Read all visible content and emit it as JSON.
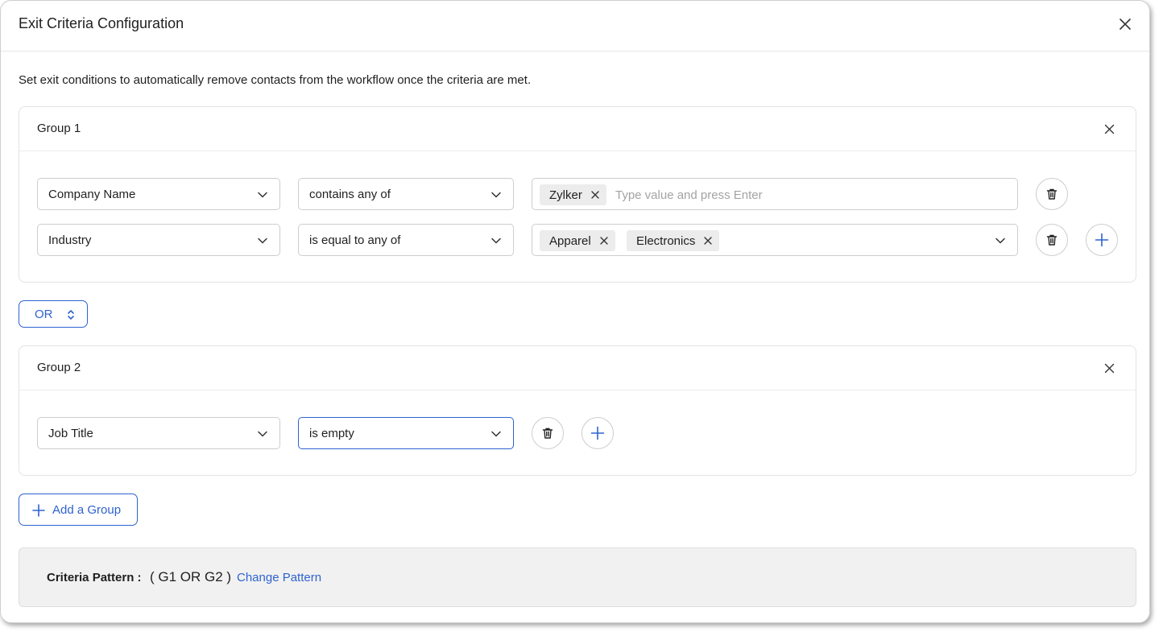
{
  "dialog": {
    "title": "Exit Criteria Configuration",
    "description": "Set exit conditions to automatically remove contacts from the workflow once the criteria are met."
  },
  "groups": [
    {
      "title": "Group 1",
      "rows": [
        {
          "field": "Company Name",
          "operator": "contains any of",
          "chips": [
            "Zylker"
          ],
          "input_placeholder": "Type value and press Enter"
        },
        {
          "field": "Industry",
          "operator": "is equal to any of",
          "chips": [
            "Apparel",
            "Electronics"
          ]
        }
      ]
    },
    {
      "title": "Group 2",
      "rows": [
        {
          "field": "Job Title",
          "operator": "is empty"
        }
      ]
    }
  ],
  "connector": {
    "label": "OR"
  },
  "add_group": {
    "label": "Add a Group"
  },
  "pattern": {
    "label": "Criteria Pattern :",
    "value": "( G1 OR G2 )",
    "change_label": "Change Pattern"
  },
  "colors": {
    "accent": "#2f62d0",
    "border": "#cdcdcd",
    "pattern_bg": "#f1f1f1"
  }
}
